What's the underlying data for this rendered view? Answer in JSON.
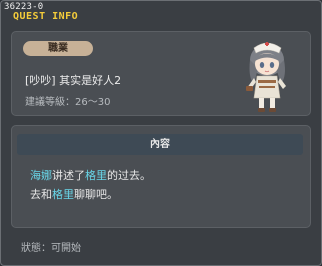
{
  "quest_id": "36223-0",
  "window_title": "QUEST INFO",
  "info": {
    "job_label": "職業",
    "quest_name": "[吵吵] 其实是好人2",
    "recommended_level": "建議等級：26～30"
  },
  "npc": {
    "icon": "nurse-npc-portrait"
  },
  "content": {
    "header": "內容",
    "line1": {
      "name1": "海娜",
      "text1": "讲述了",
      "name2": "格里",
      "text2": "的过去。"
    },
    "line2": {
      "text1": "去和",
      "name1": "格里",
      "text2": "聊聊吧。"
    }
  },
  "status": "狀態：可開始",
  "colors": {
    "title": "#f4cc3a",
    "highlight": "#68d6e8",
    "badge": "#c7b197"
  }
}
